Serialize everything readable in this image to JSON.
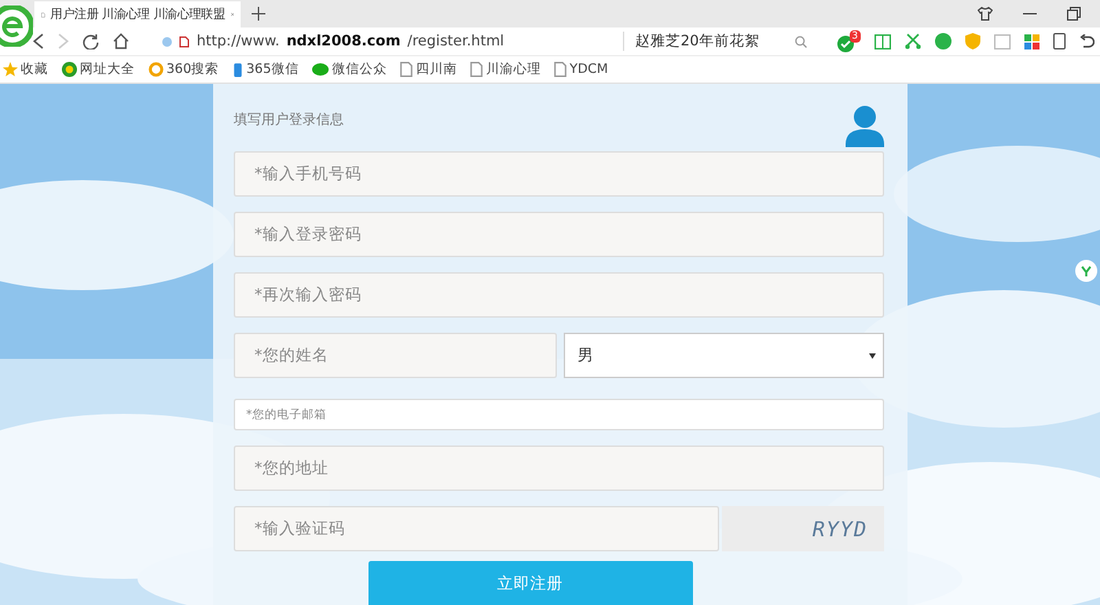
{
  "browser": {
    "tabs": [
      {
        "title": "用户注册 川渝心理 川渝心理联盟",
        "selected": true
      }
    ],
    "address": "http://www.**ndxl2008.com**/register.html",
    "search": "赵雅芝20年前花絮",
    "extension_badge": "3",
    "bookmarks": [
      {
        "label": "收藏",
        "kind": "star"
      },
      {
        "label": "网址大全",
        "kind": "globe"
      },
      {
        "label": "360搜索",
        "kind": "ring"
      },
      {
        "label": "365微信",
        "kind": "bottle"
      },
      {
        "label": "微信公众",
        "kind": "chat"
      },
      {
        "label": "四川南",
        "kind": "page"
      },
      {
        "label": "川渝心理",
        "kind": "page"
      },
      {
        "label": "YDCM",
        "kind": "page"
      }
    ]
  },
  "form": {
    "subtitle": "填写用户登录信息",
    "rows": [
      {
        "kind": "full",
        "placeholder": "*输入手机号码"
      },
      {
        "kind": "full",
        "placeholder": "*输入登录密码"
      },
      {
        "kind": "full",
        "placeholder": "*再次输入密码"
      },
      {
        "kind": "split",
        "placeholder": "*您的姓名",
        "select_value": "男"
      },
      {
        "kind": "compact",
        "placeholder": "*您的电子邮箱"
      },
      {
        "kind": "full",
        "placeholder": "*您的地址"
      },
      {
        "kind": "captcha",
        "placeholder": "*输入验证码",
        "code": "RYYD"
      }
    ],
    "submit": "立即注册"
  }
}
